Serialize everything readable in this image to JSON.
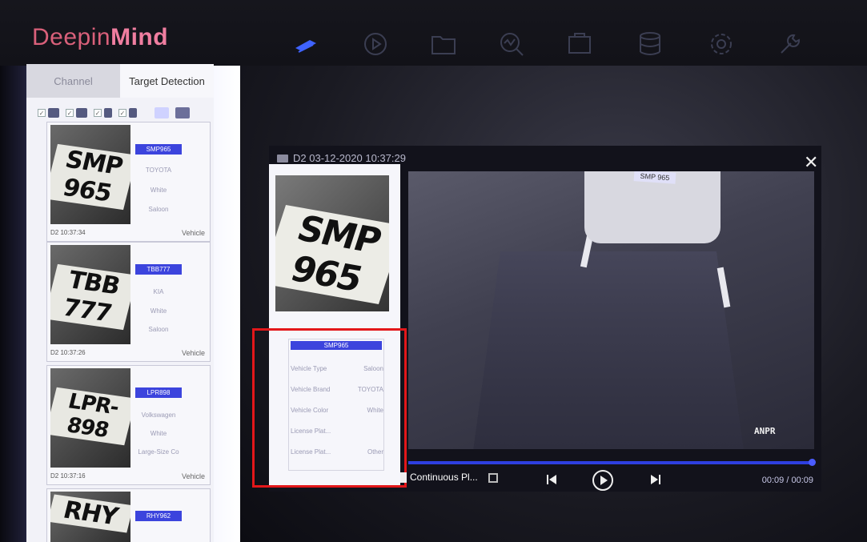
{
  "app": {
    "logo_part1": "Deepin",
    "logo_part2": "Mind"
  },
  "nav": {
    "icons": [
      "camera-icon",
      "playback-icon",
      "folder-icon",
      "search-analysis-icon",
      "video-wall-icon",
      "storage-icon",
      "settings-icon",
      "maintenance-icon"
    ],
    "active": "camera-icon"
  },
  "tabs": {
    "channel": "Channel",
    "target_detection": "Target Detection"
  },
  "filters": [
    "vehicle-filter",
    "car-filter",
    "person-filter",
    "pedestrian-filter"
  ],
  "cards": [
    {
      "plate_image_text": "SMP 965",
      "license": "SMP965",
      "brand": "TOYOTA",
      "color": "White",
      "body": "Saloon",
      "time": "D2 10:37:34",
      "type": "Vehicle"
    },
    {
      "plate_image_text": "TBB 777",
      "license": "TBB777",
      "brand": "KIA",
      "color": "White",
      "body": "Saloon",
      "time": "D2 10:37:26",
      "type": "Vehicle"
    },
    {
      "plate_image_text": "LPR-898",
      "license": "LPR898",
      "brand": "Volkswagen",
      "color": "White",
      "body": "Large-Size Co",
      "time": "D2 10:37:16",
      "type": "Vehicle"
    },
    {
      "plate_image_text": "RHY",
      "license": "RHY962",
      "brand": "",
      "color": "",
      "body": "",
      "time": "",
      "type": ""
    }
  ],
  "player": {
    "title": "D2 03-12-2020 10:37:29",
    "detail_plate_image_text": "SMP 965",
    "info": {
      "plate": "SMP965",
      "rows": [
        {
          "label": "Vehicle Type",
          "value": "Saloon"
        },
        {
          "label": "Vehicle Brand",
          "value": "TOYOTA"
        },
        {
          "label": "Vehicle Color",
          "value": "White"
        },
        {
          "label": "License Plat...",
          "value": ""
        },
        {
          "label": "License Plat...",
          "value": "Other"
        }
      ]
    },
    "video_plate": "SMP 965",
    "overlay": "ANPR",
    "mode_label": "Continuous Pl...",
    "time_readout": "00:09 / 00:09",
    "progress": 1.0
  },
  "colors": {
    "accent": "#3c44dd",
    "highlight": "#e3171a",
    "logo": "#e06a8a"
  }
}
